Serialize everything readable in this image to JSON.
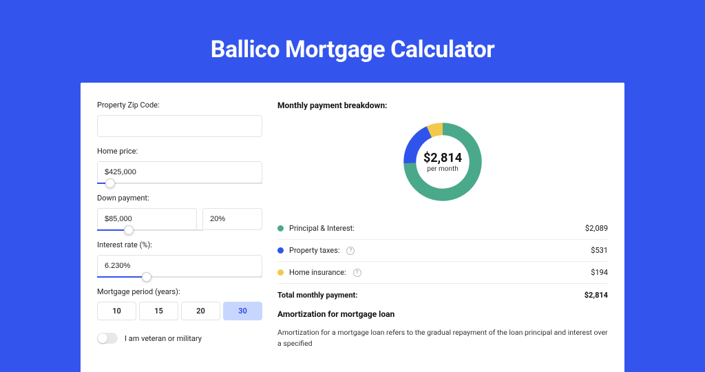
{
  "title": "Ballico Mortgage Calculator",
  "form": {
    "zip_label": "Property Zip Code:",
    "zip_value": "",
    "home_price_label": "Home price:",
    "home_price_value": "$425,000",
    "home_price_slider_pct": 8,
    "down_payment_label": "Down payment:",
    "down_payment_value": "$85,000",
    "down_payment_pct_value": "20%",
    "down_payment_slider_pct": 20,
    "interest_label": "Interest rate (%):",
    "interest_value": "6.230%",
    "interest_slider_pct": 30,
    "period_label": "Mortgage period (years):",
    "periods": [
      "10",
      "15",
      "20",
      "30"
    ],
    "period_active_index": 3,
    "veteran_label": "I am veteran or military",
    "veteran_on": false
  },
  "breakdown": {
    "title": "Monthly payment breakdown:",
    "center_amount": "$2,814",
    "center_sub": "per month",
    "items": [
      {
        "label": "Principal & Interest:",
        "amount": "$2,089",
        "color": "green",
        "help": false
      },
      {
        "label": "Property taxes:",
        "amount": "$531",
        "color": "blue",
        "help": true
      },
      {
        "label": "Home insurance:",
        "amount": "$194",
        "color": "yellow",
        "help": true
      }
    ],
    "total_label": "Total monthly payment:",
    "total_amount": "$2,814"
  },
  "amortization": {
    "title": "Amortization for mortgage loan",
    "text": "Amortization for a mortgage loan refers to the gradual repayment of the loan principal and interest over a specified"
  },
  "chart_data": {
    "type": "pie",
    "title": "Monthly payment breakdown",
    "series": [
      {
        "name": "Principal & Interest",
        "value": 2089,
        "color": "#4aa98b"
      },
      {
        "name": "Property taxes",
        "value": 531,
        "color": "#2f54eb"
      },
      {
        "name": "Home insurance",
        "value": 194,
        "color": "#f2c94c"
      }
    ],
    "total": 2814,
    "center_label": "$2,814 per month"
  }
}
